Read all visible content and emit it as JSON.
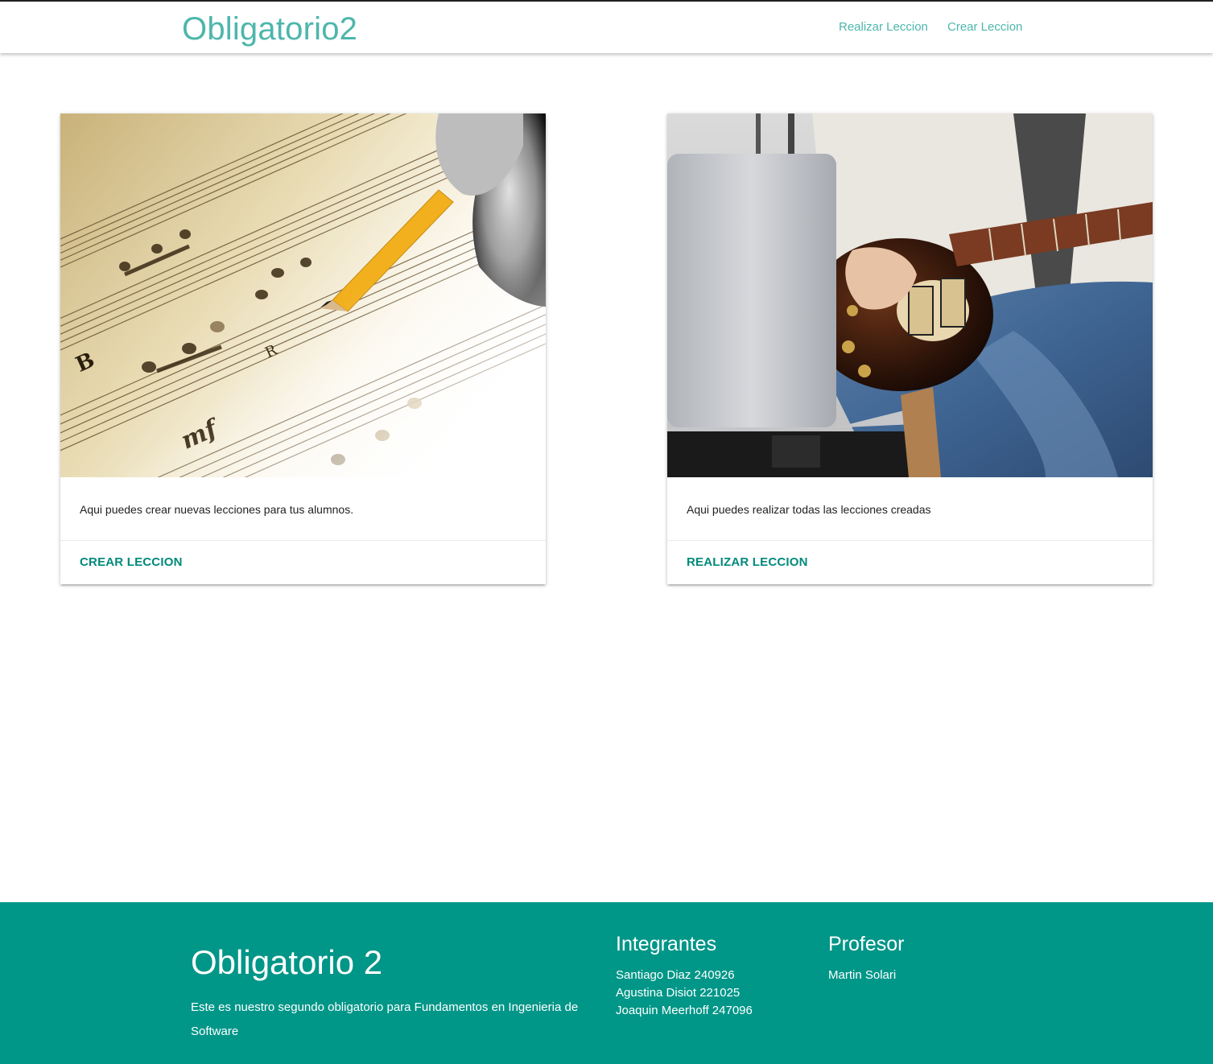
{
  "navbar": {
    "brand": "Obligatorio2",
    "links": [
      "Realizar Leccion",
      "Crear Leccion"
    ]
  },
  "cards": [
    {
      "image": "sheet-music-pencil-image",
      "text": "Aqui puedes crear nuevas lecciones para tus alumnos.",
      "action": "CREAR LECCION"
    },
    {
      "image": "guitar-laptop-image",
      "text": "Aqui puedes realizar todas las lecciones creadas",
      "action": "REALIZAR LECCION"
    }
  ],
  "footer": {
    "title": "Obligatorio 2",
    "description": "Este es nuestro segundo obligatorio para Fundamentos en Ingenieria de Software",
    "integrantes_heading": "Integrantes",
    "integrantes": [
      "Santiago Diaz 240926",
      "Agustina Disiot 221025",
      "Joaquin Meerhoff 247096"
    ],
    "profesor_heading": "Profesor",
    "profesor": "Martin Solari"
  },
  "colors": {
    "accent": "#4db6ac",
    "footer_bg": "#009688",
    "action": "#00897b"
  }
}
